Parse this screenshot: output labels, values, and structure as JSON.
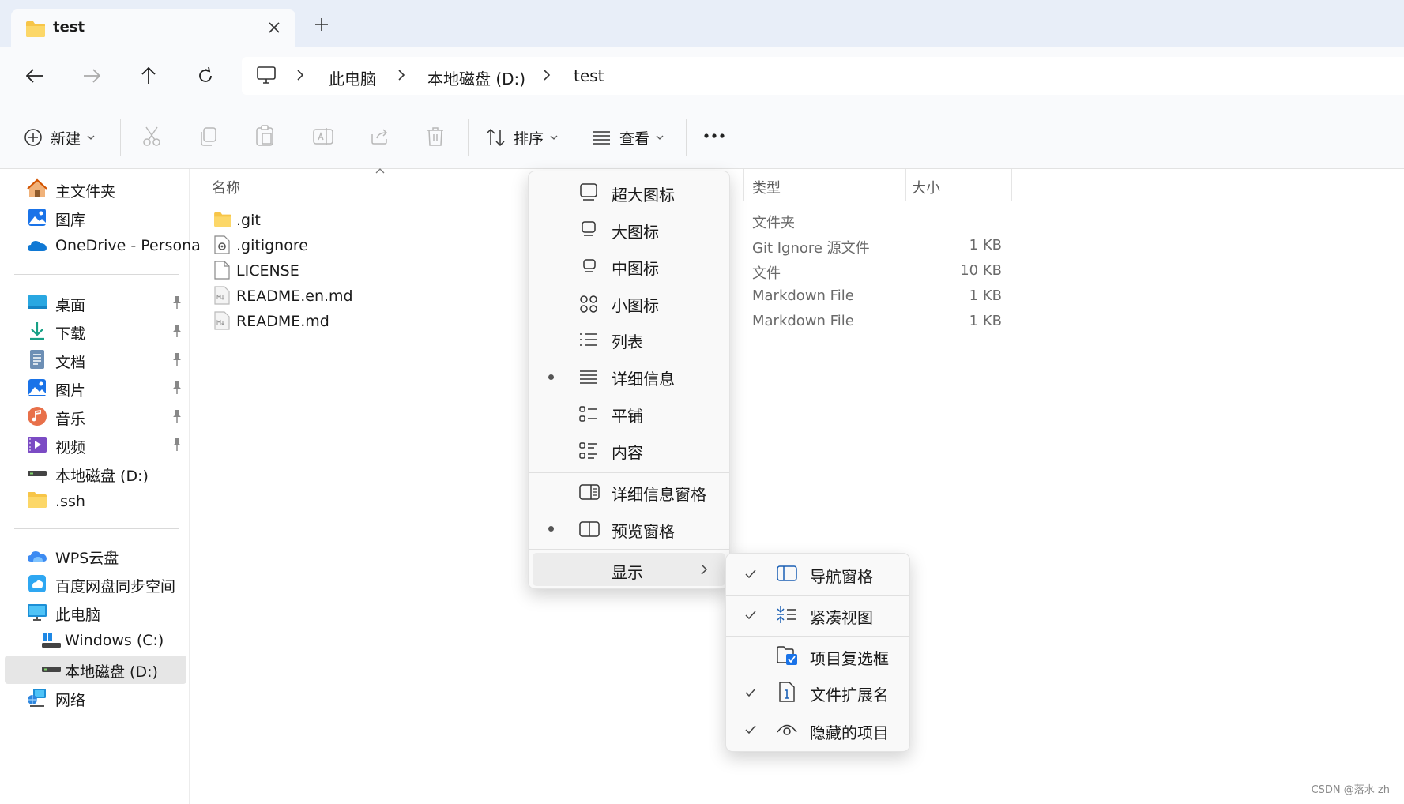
{
  "tab": {
    "title": "test"
  },
  "breadcrumb": [
    "此电脑",
    "本地磁盘 (D:)",
    "test"
  ],
  "toolbar": {
    "new_label": "新建",
    "sort_label": "排序",
    "view_label": "查看"
  },
  "sidebar": {
    "top": [
      {
        "label": "主文件夹",
        "icon": "home-icon"
      },
      {
        "label": "图库",
        "icon": "gallery-icon"
      },
      {
        "label": "OneDrive - Persona",
        "icon": "onedrive-icon"
      }
    ],
    "pinned": [
      {
        "label": "桌面",
        "icon": "desktop-icon"
      },
      {
        "label": "下载",
        "icon": "download-icon"
      },
      {
        "label": "文档",
        "icon": "documents-icon"
      },
      {
        "label": "图片",
        "icon": "pictures-icon"
      },
      {
        "label": "音乐",
        "icon": "music-icon"
      },
      {
        "label": "视频",
        "icon": "videos-icon"
      },
      {
        "label": "本地磁盘 (D:)",
        "icon": "drive-icon"
      },
      {
        "label": ".ssh",
        "icon": "folder-icon"
      }
    ],
    "bottom": [
      {
        "label": "WPS云盘",
        "icon": "wps-cloud-icon"
      },
      {
        "label": "百度网盘同步空间",
        "icon": "baidu-netdisk-icon"
      },
      {
        "label": "此电脑",
        "icon": "this-pc-icon"
      },
      {
        "label": "Windows (C:)",
        "icon": "windows-drive-icon"
      },
      {
        "label": "本地磁盘 (D:)",
        "icon": "drive-icon"
      },
      {
        "label": "网络",
        "icon": "network-icon"
      }
    ]
  },
  "columns": {
    "name": "名称",
    "type": "类型",
    "size": "大小"
  },
  "files": [
    {
      "name": ".git",
      "type": "文件夹",
      "size": "",
      "icon": "folder-icon"
    },
    {
      "name": ".gitignore",
      "type": "Git Ignore 源文件",
      "size": "1 KB",
      "icon": "settings-file-icon"
    },
    {
      "name": "LICENSE",
      "type": "文件",
      "size": "10 KB",
      "icon": "file-icon"
    },
    {
      "name": "README.en.md",
      "type": "Markdown File",
      "size": "1 KB",
      "icon": "markdown-file-icon"
    },
    {
      "name": "README.md",
      "type": "Markdown File",
      "size": "1 KB",
      "icon": "markdown-file-icon"
    }
  ],
  "view_menu": {
    "items": [
      {
        "label": "超大图标",
        "icon": "extra-large-icons-icon",
        "selected": false
      },
      {
        "label": "大图标",
        "icon": "large-icons-icon",
        "selected": false
      },
      {
        "label": "中图标",
        "icon": "medium-icons-icon",
        "selected": false
      },
      {
        "label": "小图标",
        "icon": "small-icons-icon",
        "selected": false
      },
      {
        "label": "列表",
        "icon": "list-view-icon",
        "selected": false
      },
      {
        "label": "详细信息",
        "icon": "details-view-icon",
        "selected": true
      },
      {
        "label": "平铺",
        "icon": "tiles-view-icon",
        "selected": false
      },
      {
        "label": "内容",
        "icon": "content-view-icon",
        "selected": false
      }
    ],
    "panes": [
      {
        "label": "详细信息窗格",
        "icon": "details-pane-icon",
        "selected": false
      },
      {
        "label": "预览窗格",
        "icon": "preview-pane-icon",
        "selected": true
      }
    ],
    "show_label": "显示"
  },
  "show_submenu": {
    "items": [
      {
        "label": "导航窗格",
        "icon": "navigation-pane-icon",
        "checked": true
      },
      {
        "label": "紧凑视图",
        "icon": "compact-view-icon",
        "checked": true
      },
      {
        "label": "项目复选框",
        "icon": "item-checkbox-icon",
        "checked": false
      },
      {
        "label": "文件扩展名",
        "icon": "file-extension-icon",
        "checked": true
      },
      {
        "label": "隐藏的项目",
        "icon": "hidden-items-icon",
        "checked": true
      }
    ]
  },
  "watermark": "CSDN @落水 zh"
}
